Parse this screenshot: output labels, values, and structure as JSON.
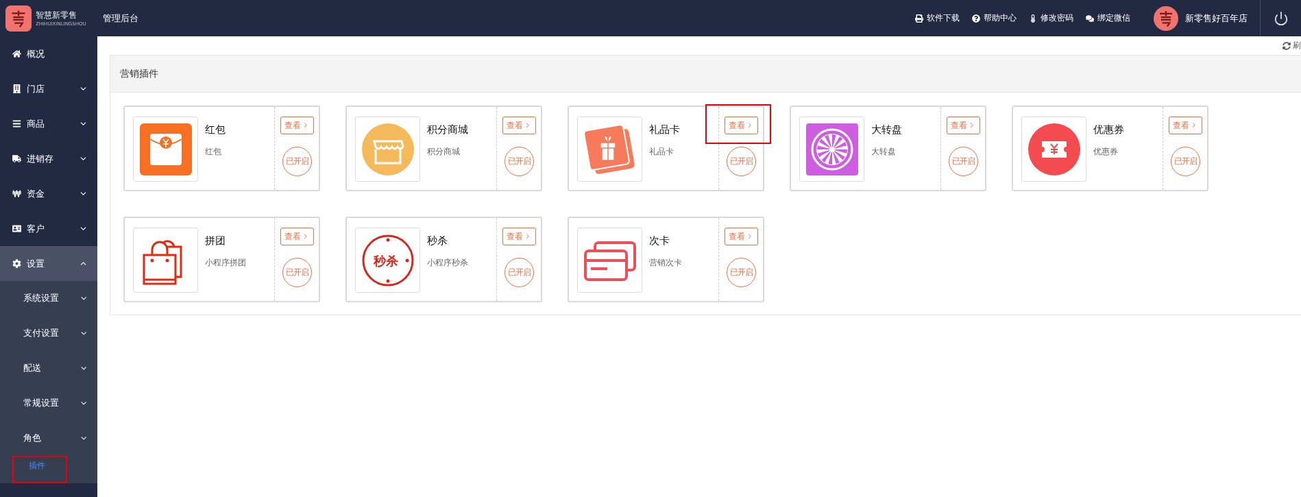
{
  "header": {
    "brand": "智慧新零售",
    "brand_sub": "ZHIHUIXINLINGSHOU",
    "title": "管理后台",
    "links": [
      {
        "kind": "print",
        "label": "软件下载"
      },
      {
        "kind": "help",
        "label": "帮助中心"
      },
      {
        "kind": "thermo",
        "label": "修改密码"
      },
      {
        "kind": "chat",
        "label": "绑定微信"
      }
    ],
    "store": "新零售好百年店"
  },
  "sidebar": {
    "items": [
      {
        "kind": "home",
        "label": "概况",
        "expanded": false,
        "has_children": false
      },
      {
        "kind": "building",
        "label": "门店",
        "expanded": false,
        "has_children": true
      },
      {
        "kind": "bars",
        "label": "商品",
        "expanded": false,
        "has_children": true
      },
      {
        "kind": "truck",
        "label": "进销存",
        "expanded": false,
        "has_children": true
      },
      {
        "kind": "won",
        "label": "资金",
        "expanded": false,
        "has_children": true
      },
      {
        "kind": "card",
        "label": "客户",
        "expanded": false,
        "has_children": true
      },
      {
        "kind": "cog",
        "label": "设置",
        "expanded": true,
        "has_children": true,
        "children": [
          {
            "label": "系统设置",
            "selected": false,
            "has_children": true,
            "highlighted": false
          },
          {
            "label": "支付设置",
            "selected": false,
            "has_children": true,
            "highlighted": false
          },
          {
            "label": "配送",
            "selected": false,
            "has_children": true,
            "highlighted": false
          },
          {
            "label": "常规设置",
            "selected": false,
            "has_children": true,
            "highlighted": false
          },
          {
            "label": "角色",
            "selected": false,
            "has_children": true,
            "highlighted": false
          },
          {
            "label": "插件",
            "selected": true,
            "has_children": false,
            "highlighted": true
          }
        ]
      }
    ]
  },
  "refresh": "刷",
  "panel": {
    "title": "营销插件",
    "plugins": [
      {
        "kind": "redpacket",
        "name": "红包",
        "desc": "红包",
        "view": "查看",
        "status": "已开启",
        "enabled": true,
        "highlighted": false
      },
      {
        "kind": "store",
        "name": "积分商城",
        "desc": "积分商城",
        "view": "查看",
        "status": "已开启",
        "enabled": true,
        "highlighted": false
      },
      {
        "kind": "giftcard",
        "name": "礼品卡",
        "desc": "礼品卡",
        "view": "查看",
        "status": "已开启",
        "enabled": true,
        "highlighted": true
      },
      {
        "kind": "wheel",
        "name": "大转盘",
        "desc": "大转盘",
        "view": "查看",
        "status": "已开启",
        "enabled": true,
        "highlighted": false
      },
      {
        "kind": "coupon",
        "name": "优惠券",
        "desc": "优惠券",
        "view": "查看",
        "status": "已开启",
        "enabled": true,
        "highlighted": false
      },
      {
        "kind": "bags",
        "name": "拼团",
        "desc": "小程序拼团",
        "view": "查看",
        "status": "已开启",
        "enabled": true,
        "highlighted": false
      },
      {
        "kind": "seckill",
        "name": "秒杀",
        "desc": "小程序秒杀",
        "view": "查看",
        "status": "已开启",
        "enabled": true,
        "highlighted": false,
        "icon_text": "秒杀"
      },
      {
        "kind": "timescard",
        "name": "次卡",
        "desc": "营销次卡",
        "view": "查看",
        "status": "已开启",
        "enabled": true,
        "highlighted": false
      }
    ]
  }
}
